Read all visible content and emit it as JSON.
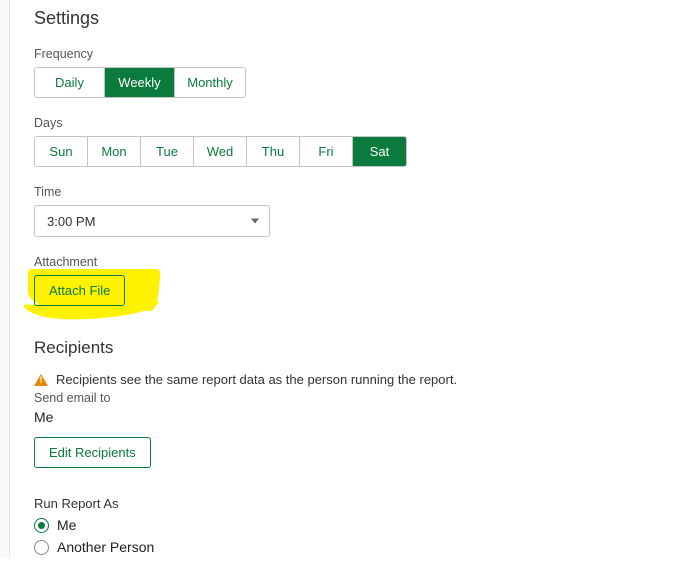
{
  "settings": {
    "title": "Settings",
    "frequency": {
      "label": "Frequency",
      "options": [
        "Daily",
        "Weekly",
        "Monthly"
      ],
      "selected": "Weekly"
    },
    "days": {
      "label": "Days",
      "options": [
        "Sun",
        "Mon",
        "Tue",
        "Wed",
        "Thu",
        "Fri",
        "Sat"
      ],
      "selected": "Sat"
    },
    "time": {
      "label": "Time",
      "value": "3:00 PM"
    },
    "attachment": {
      "label": "Attachment",
      "button": "Attach File"
    }
  },
  "recipients": {
    "title": "Recipients",
    "warning": "Recipients see the same report data as the person running the report.",
    "send_to_label": "Send email to",
    "send_to_value": "Me",
    "edit_button": "Edit Recipients"
  },
  "run_as": {
    "label": "Run Report As",
    "options": [
      "Me",
      "Another Person"
    ],
    "selected": "Me"
  }
}
